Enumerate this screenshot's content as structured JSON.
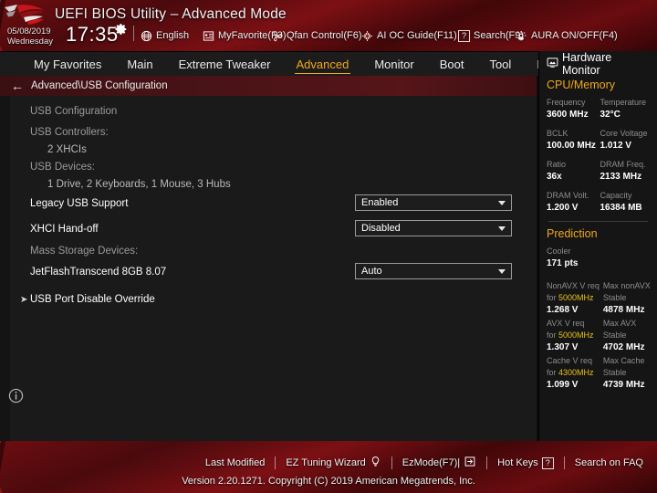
{
  "header": {
    "title": "UEFI BIOS Utility – Advanced Mode",
    "logo_icon": "rog-eye-logo",
    "date": "05/08/2019",
    "weekday": "Wednesday",
    "time": "17:35",
    "gear_icon": "gear-icon",
    "items": [
      {
        "label": "English",
        "icon": "globe-icon"
      },
      {
        "label": "MyFavorite(F3)",
        "icon": "star-list-icon"
      },
      {
        "label": "Qfan Control(F6)",
        "icon": "fan-icon"
      },
      {
        "label": "AI OC Guide(F11)",
        "icon": "ai-chip-icon"
      },
      {
        "label": "Search(F9)",
        "icon": "question-box-icon"
      },
      {
        "label": "AURA ON/OFF(F4)",
        "icon": "aura-light-icon"
      }
    ]
  },
  "nav": {
    "tabs": [
      {
        "label": "My Favorites",
        "active": false
      },
      {
        "label": "Main",
        "active": false
      },
      {
        "label": "Extreme Tweaker",
        "active": false
      },
      {
        "label": "Advanced",
        "active": true
      },
      {
        "label": "Monitor",
        "active": false
      },
      {
        "label": "Boot",
        "active": false
      },
      {
        "label": "Tool",
        "active": false
      },
      {
        "label": "Exit",
        "active": false
      }
    ],
    "active_color": "#f0a81e"
  },
  "breadcrumb": {
    "back_icon": "back-arrow-icon",
    "path": "Advanced\\USB Configuration"
  },
  "main": {
    "info_icon": "info-circle-icon",
    "rows": [
      {
        "type": "static",
        "label": "USB Configuration",
        "style": "dim"
      },
      {
        "type": "static",
        "label": "USB Controllers:",
        "style": "dim"
      },
      {
        "type": "static",
        "label": "2 XHCIs",
        "style": "indent"
      },
      {
        "type": "static",
        "label": "USB Devices:",
        "style": "dim"
      },
      {
        "type": "static",
        "label": "1 Drive, 2 Keyboards, 1 Mouse, 3 Hubs",
        "style": "indent"
      },
      {
        "type": "select",
        "label": "Legacy USB Support",
        "style": "bold",
        "value": "Enabled"
      },
      {
        "type": "select",
        "label": "XHCI Hand-off",
        "style": "bold",
        "value": "Disabled"
      },
      {
        "type": "static",
        "label": "Mass Storage Devices:",
        "style": "dim"
      },
      {
        "type": "select",
        "label": "JetFlashTranscend 8GB 8.07",
        "style": "bold",
        "value": "Auto"
      },
      {
        "type": "submenu",
        "label": "USB Port Disable Override",
        "style": "bold",
        "arrow_icon": "submenu-arrow-icon"
      }
    ]
  },
  "sidebar": {
    "title": "Hardware Monitor",
    "title_icon": "monitor-icon",
    "sections": [
      {
        "name": "CPU/Memory",
        "pairs": [
          [
            {
              "label": "Frequency",
              "value": "3600 MHz"
            },
            {
              "label": "Temperature",
              "value": "32°C"
            }
          ],
          [
            {
              "label": "BCLK",
              "value": "100.00 MHz"
            },
            {
              "label": "Core Voltage",
              "value": "1.012 V"
            }
          ],
          [
            {
              "label": "Ratio",
              "value": "36x"
            },
            {
              "label": "DRAM Freq.",
              "value": "2133 MHz"
            }
          ],
          [
            {
              "label": "DRAM Volt.",
              "value": "1.200 V"
            },
            {
              "label": "Capacity",
              "value": "16384 MB"
            }
          ]
        ]
      },
      {
        "name": "Prediction",
        "cooler_label": "Cooler",
        "cooler_value": "171 pts",
        "pairs": [
          [
            {
              "label": "NonAVX V req",
              "label2_pre": "for ",
              "label2_hl": "5000MHz",
              "value": "1.268 V"
            },
            {
              "label": "Max nonAVX",
              "label2_pre": "Stable",
              "label2_hl": "",
              "value": "4878 MHz"
            }
          ],
          [
            {
              "label": "AVX V req",
              "label2_pre": "for ",
              "label2_hl": "5000MHz",
              "value": "1.307 V"
            },
            {
              "label": "Max AVX",
              "label2_pre": "Stable",
              "label2_hl": "",
              "value": "4702 MHz"
            }
          ],
          [
            {
              "label": "Cache V req",
              "label2_pre": "for ",
              "label2_hl": "4300MHz",
              "value": "1.099 V"
            },
            {
              "label": "Max Cache",
              "label2_pre": "Stable",
              "label2_hl": "",
              "value": "4739 MHz"
            }
          ]
        ]
      }
    ],
    "highlight_color": "#e8c21a"
  },
  "footer": {
    "items": [
      {
        "label": "Last Modified",
        "icon": ""
      },
      {
        "label": "EZ Tuning Wizard",
        "icon": "bulb-icon"
      },
      {
        "label": "EzMode(F7)|",
        "icon": "exit-arrow-icon"
      },
      {
        "label": "Hot Keys",
        "icon": "question-box-icon"
      },
      {
        "label": "Search on FAQ",
        "icon": ""
      }
    ],
    "version": "Version 2.20.1271. Copyright (C) 2019 American Megatrends, Inc."
  }
}
